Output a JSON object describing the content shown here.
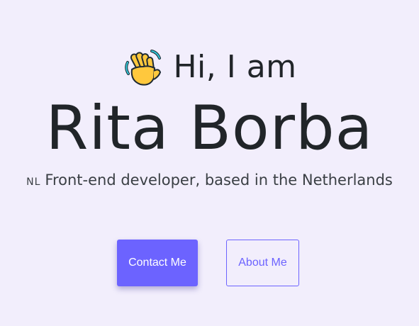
{
  "hero": {
    "greeting": "Hi, I am",
    "greeting_icon": "waving-hand-icon",
    "name": "Rita Borba",
    "flag_code": "NL",
    "subtitle": "Front-end developer, based in the Netherlands"
  },
  "buttons": {
    "contact_label": "Contact Me",
    "about_label": "About Me"
  },
  "colors": {
    "background": "#f2eefc",
    "accent": "#6c63ff",
    "text": "#212529"
  }
}
